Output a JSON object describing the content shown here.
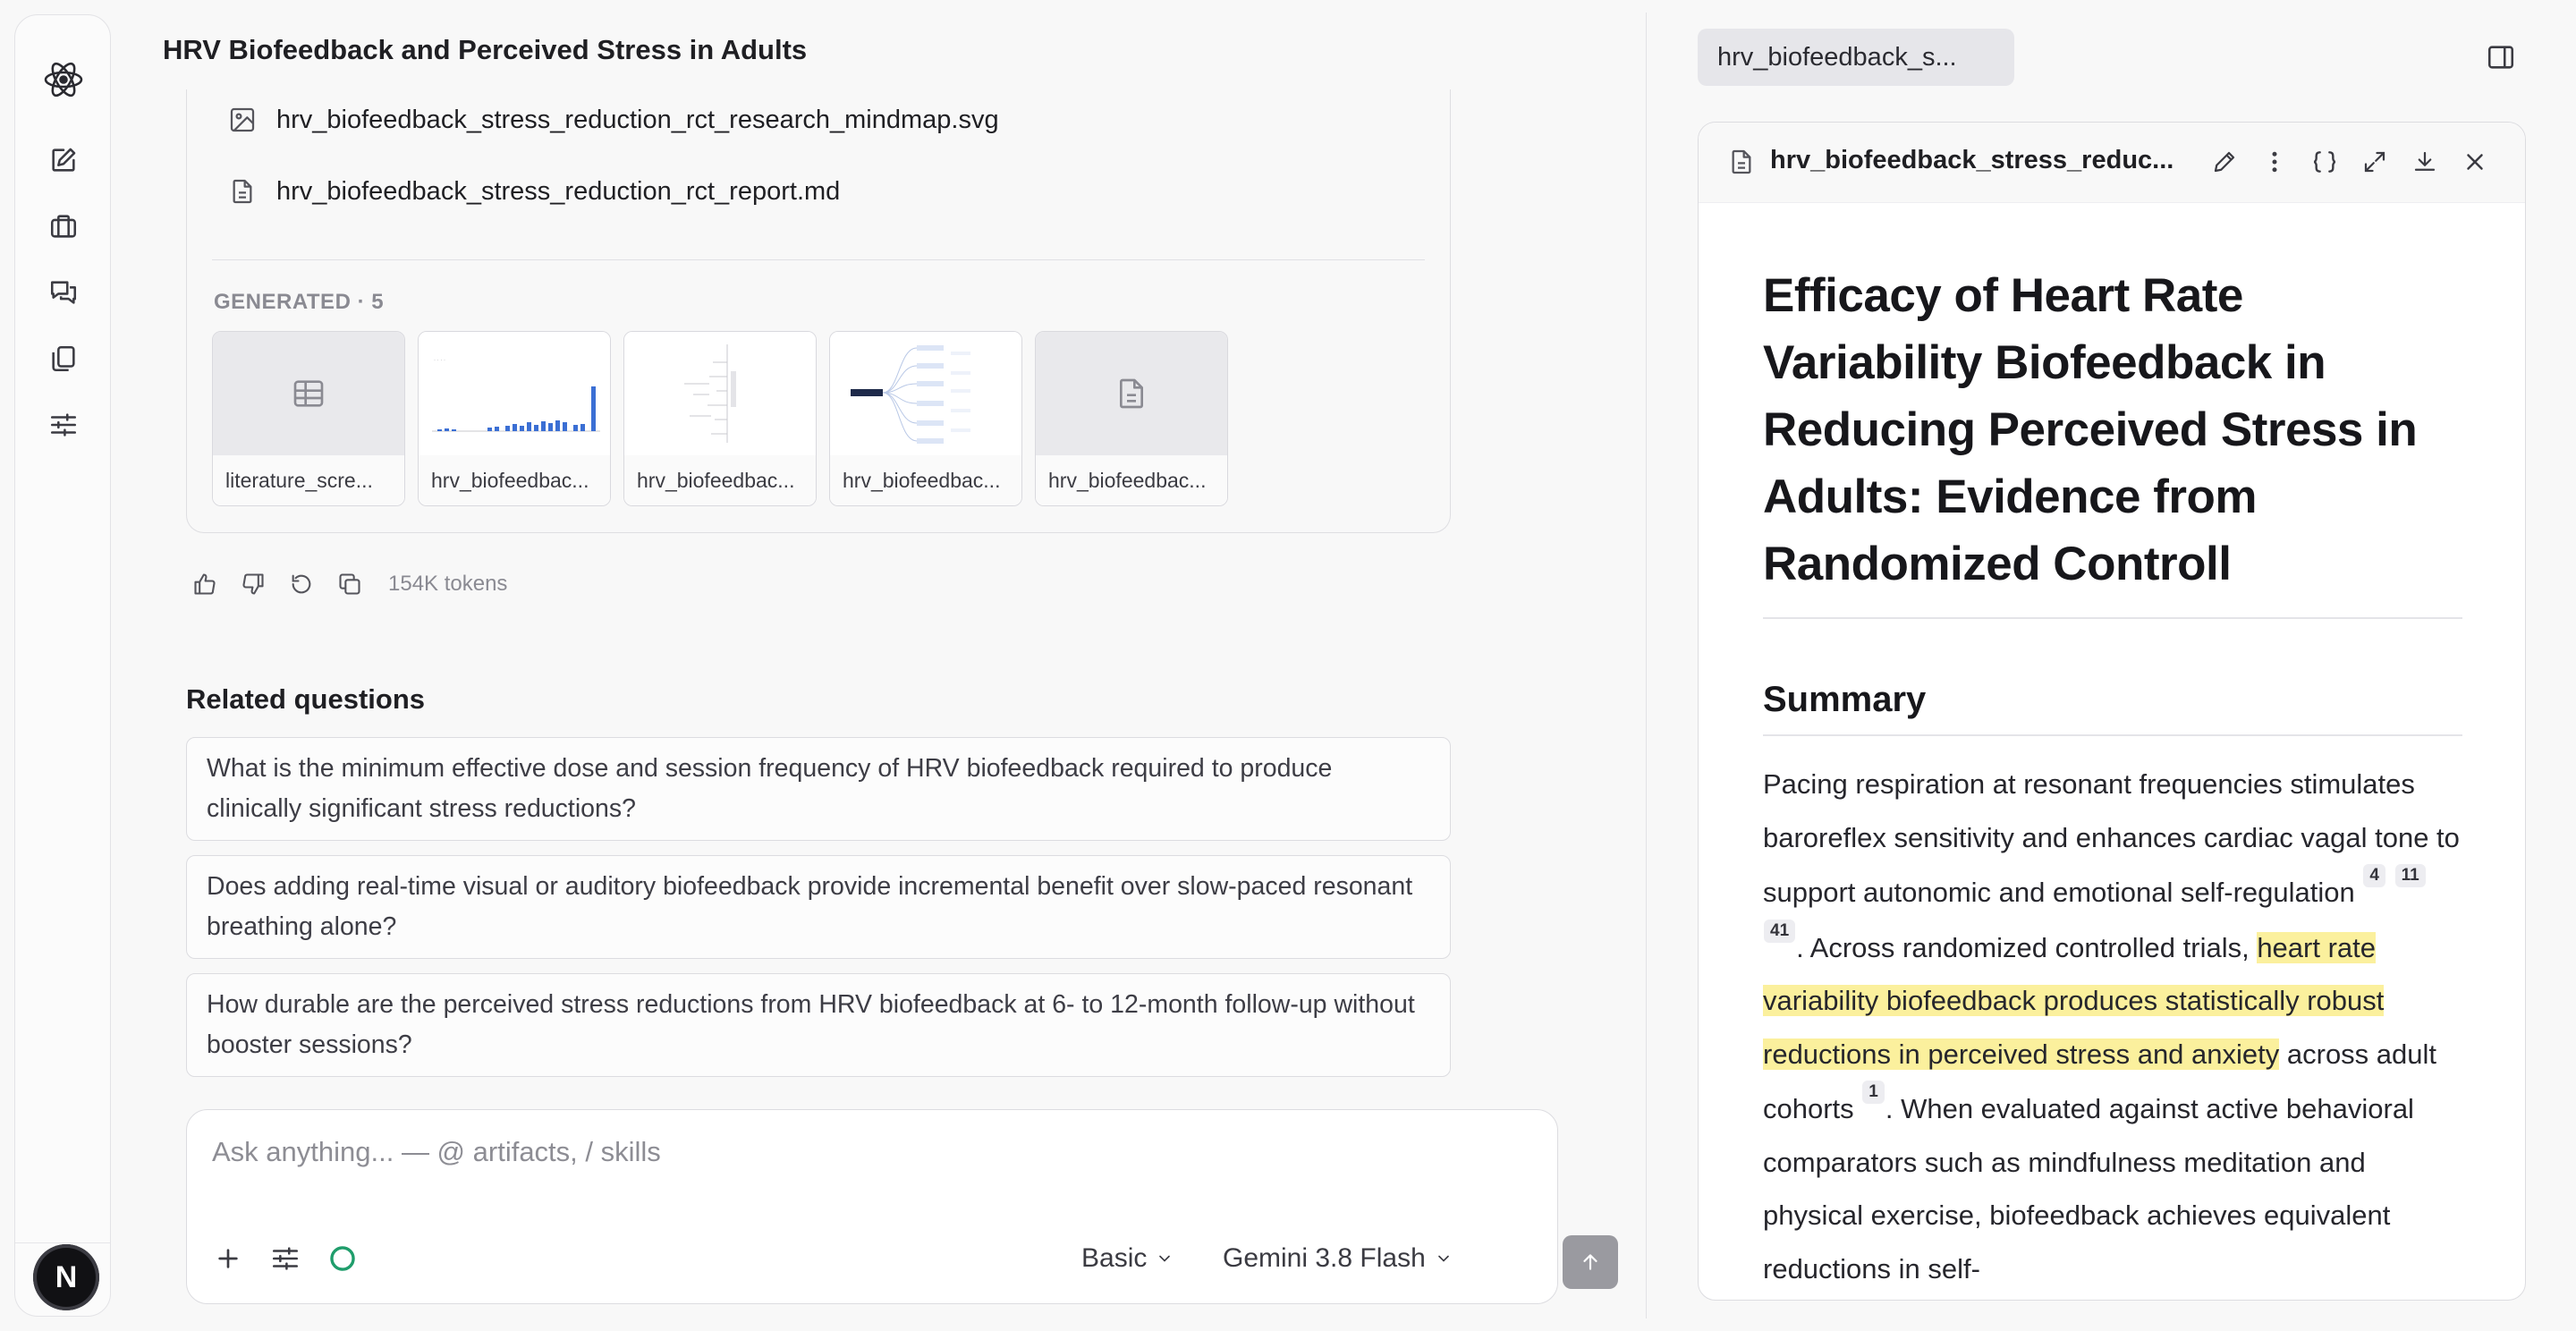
{
  "app": {
    "title": "HRV Biofeedback and Perceived Stress in Adults",
    "avatar_letter": "N"
  },
  "sidebar": {
    "icons": [
      "atom-logo-icon",
      "new-chat-icon",
      "briefcase-icon",
      "chats-icon",
      "copy-files-icon",
      "sliders-icon"
    ]
  },
  "attachments": [
    {
      "name": "hrv_biofeedback_stress_reduction_rct_research_mindmap.svg",
      "icon": "image-icon"
    },
    {
      "name": "hrv_biofeedback_stress_reduction_rct_report.md",
      "icon": "document-icon"
    }
  ],
  "generated": {
    "label": "GENERATED · 5",
    "items": [
      {
        "caption": "literature_scre...",
        "kind": "table"
      },
      {
        "caption": "hrv_biofeedbac...",
        "kind": "chart"
      },
      {
        "caption": "hrv_biofeedbac...",
        "kind": "tree"
      },
      {
        "caption": "hrv_biofeedbac...",
        "kind": "mindmap"
      },
      {
        "caption": "hrv_biofeedbac...",
        "kind": "document"
      }
    ]
  },
  "message_actions": {
    "tokens": "154K tokens"
  },
  "related": {
    "title": "Related questions",
    "questions": [
      "What is the minimum effective dose and session frequency of HRV biofeedback required to produce clinically significant stress reductions?",
      "Does adding real-time visual or auditory biofeedback provide incremental benefit over slow-paced resonant breathing alone?",
      "How durable are the perceived stress reductions from HRV biofeedback at 6- to 12-month follow-up without booster sessions?"
    ]
  },
  "composer": {
    "placeholder": "Ask anything... — @ artifacts, / skills",
    "mode": "Basic",
    "model": "Gemini 3.8 Flash"
  },
  "panel": {
    "tab_label": "hrv_biofeedback_s...",
    "file_name": "hrv_biofeedback_stress_reduc...",
    "doc_title": "Efficacy of Heart Rate Variability Biofeedback in Reducing Perceived Stress in Adults: Evidence from Randomized Controll",
    "section_title": "Summary",
    "para": {
      "t1": "Pacing respiration at resonant frequencies stimulates baroreflex sensitivity and enhances cardiac vagal tone to support autonomic and emotional self-regulation ",
      "c1": "4",
      "c2": "11",
      "c3": "41",
      "t2": ". Across randomized controlled trials, ",
      "highlight": "heart rate variability biofeedback produces statistically robust reductions in perceived stress and anxiety",
      "t3": " across adult cohorts ",
      "c4": "1",
      "t4": ". When evaluated against active behavioral comparators such as mindfulness meditation and physical exercise, biofeedback achieves equivalent reductions in self-"
    }
  },
  "colors": {
    "highlight": "#fbf09d",
    "status_ring": "#1f9d6b",
    "send_disabled": "#9a9aa0"
  }
}
